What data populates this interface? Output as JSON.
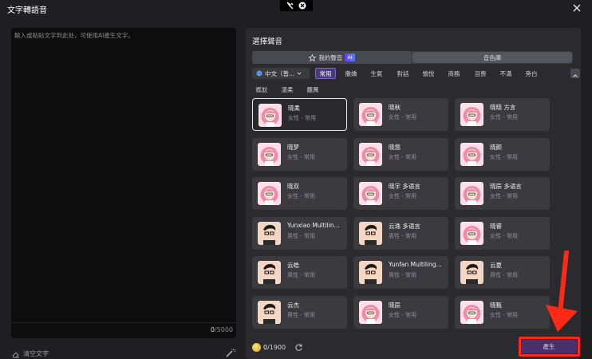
{
  "window": {
    "title": "文字轉語音"
  },
  "editor": {
    "placeholder": "輸入或貼貼文字到此处，可使用AI產生文字。",
    "count_current": "0",
    "count_max": "/5000",
    "clear_label": "清空文字"
  },
  "voices_panel": {
    "title": "選擇聲音",
    "tabs": [
      {
        "label": "我的聲音",
        "badge": "AI"
      },
      {
        "label": "音色庫"
      }
    ],
    "language": "中文（普...",
    "styles": [
      "常用",
      "撒嬌",
      "生氣",
      "對話",
      "愉悅",
      "商務",
      "沮喪",
      "不滿",
      "旁白",
      "尷尬",
      "溫柔",
      "嚴厲"
    ],
    "active_style": "常用",
    "voices": [
      {
        "name": "晓柔",
        "desc": "女性 - 常用",
        "gender": "female",
        "selected": true
      },
      {
        "name": "晓秋",
        "desc": "女性 - 常用",
        "gender": "female"
      },
      {
        "name": "晓晓 方言",
        "desc": "女性 - 常用",
        "gender": "female"
      },
      {
        "name": "晓梦",
        "desc": "女性 - 常用",
        "gender": "female"
      },
      {
        "name": "晓悠",
        "desc": "女性 - 常用",
        "gender": "female"
      },
      {
        "name": "晓颜",
        "desc": "女性 - 常用",
        "gender": "female"
      },
      {
        "name": "晓双",
        "desc": "女性 - 常用",
        "gender": "female"
      },
      {
        "name": "晓宇 多语言",
        "desc": "女性 - 常用",
        "gender": "female"
      },
      {
        "name": "晓辰 多语言",
        "desc": "女性 - 常用",
        "gender": "female"
      },
      {
        "name": "Yunxiao Multilin...",
        "desc": "男性 - 常用",
        "gender": "male"
      },
      {
        "name": "云逸 多语言",
        "desc": "男性 - 常用",
        "gender": "male"
      },
      {
        "name": "晓睿",
        "desc": "女性 - 常用",
        "gender": "female"
      },
      {
        "name": "云皓",
        "desc": "男性 - 常用",
        "gender": "male"
      },
      {
        "name": "Yunfan Multiling...",
        "desc": "男性 - 常用",
        "gender": "male"
      },
      {
        "name": "云夏",
        "desc": "男性 - 常用",
        "gender": "male"
      },
      {
        "name": "云杰",
        "desc": "男性 - 常用",
        "gender": "male"
      },
      {
        "name": "晓辰",
        "desc": "女性 - 常用",
        "gender": "female"
      },
      {
        "name": "晓甄",
        "desc": "女性 - 常用",
        "gender": "female"
      }
    ],
    "credits_used": "0",
    "credits_total": "/1900",
    "generate_label": "產生"
  },
  "colors": {
    "accent": "#7c62d8",
    "highlight": "#ff2a16",
    "background": "#1f1f22"
  }
}
